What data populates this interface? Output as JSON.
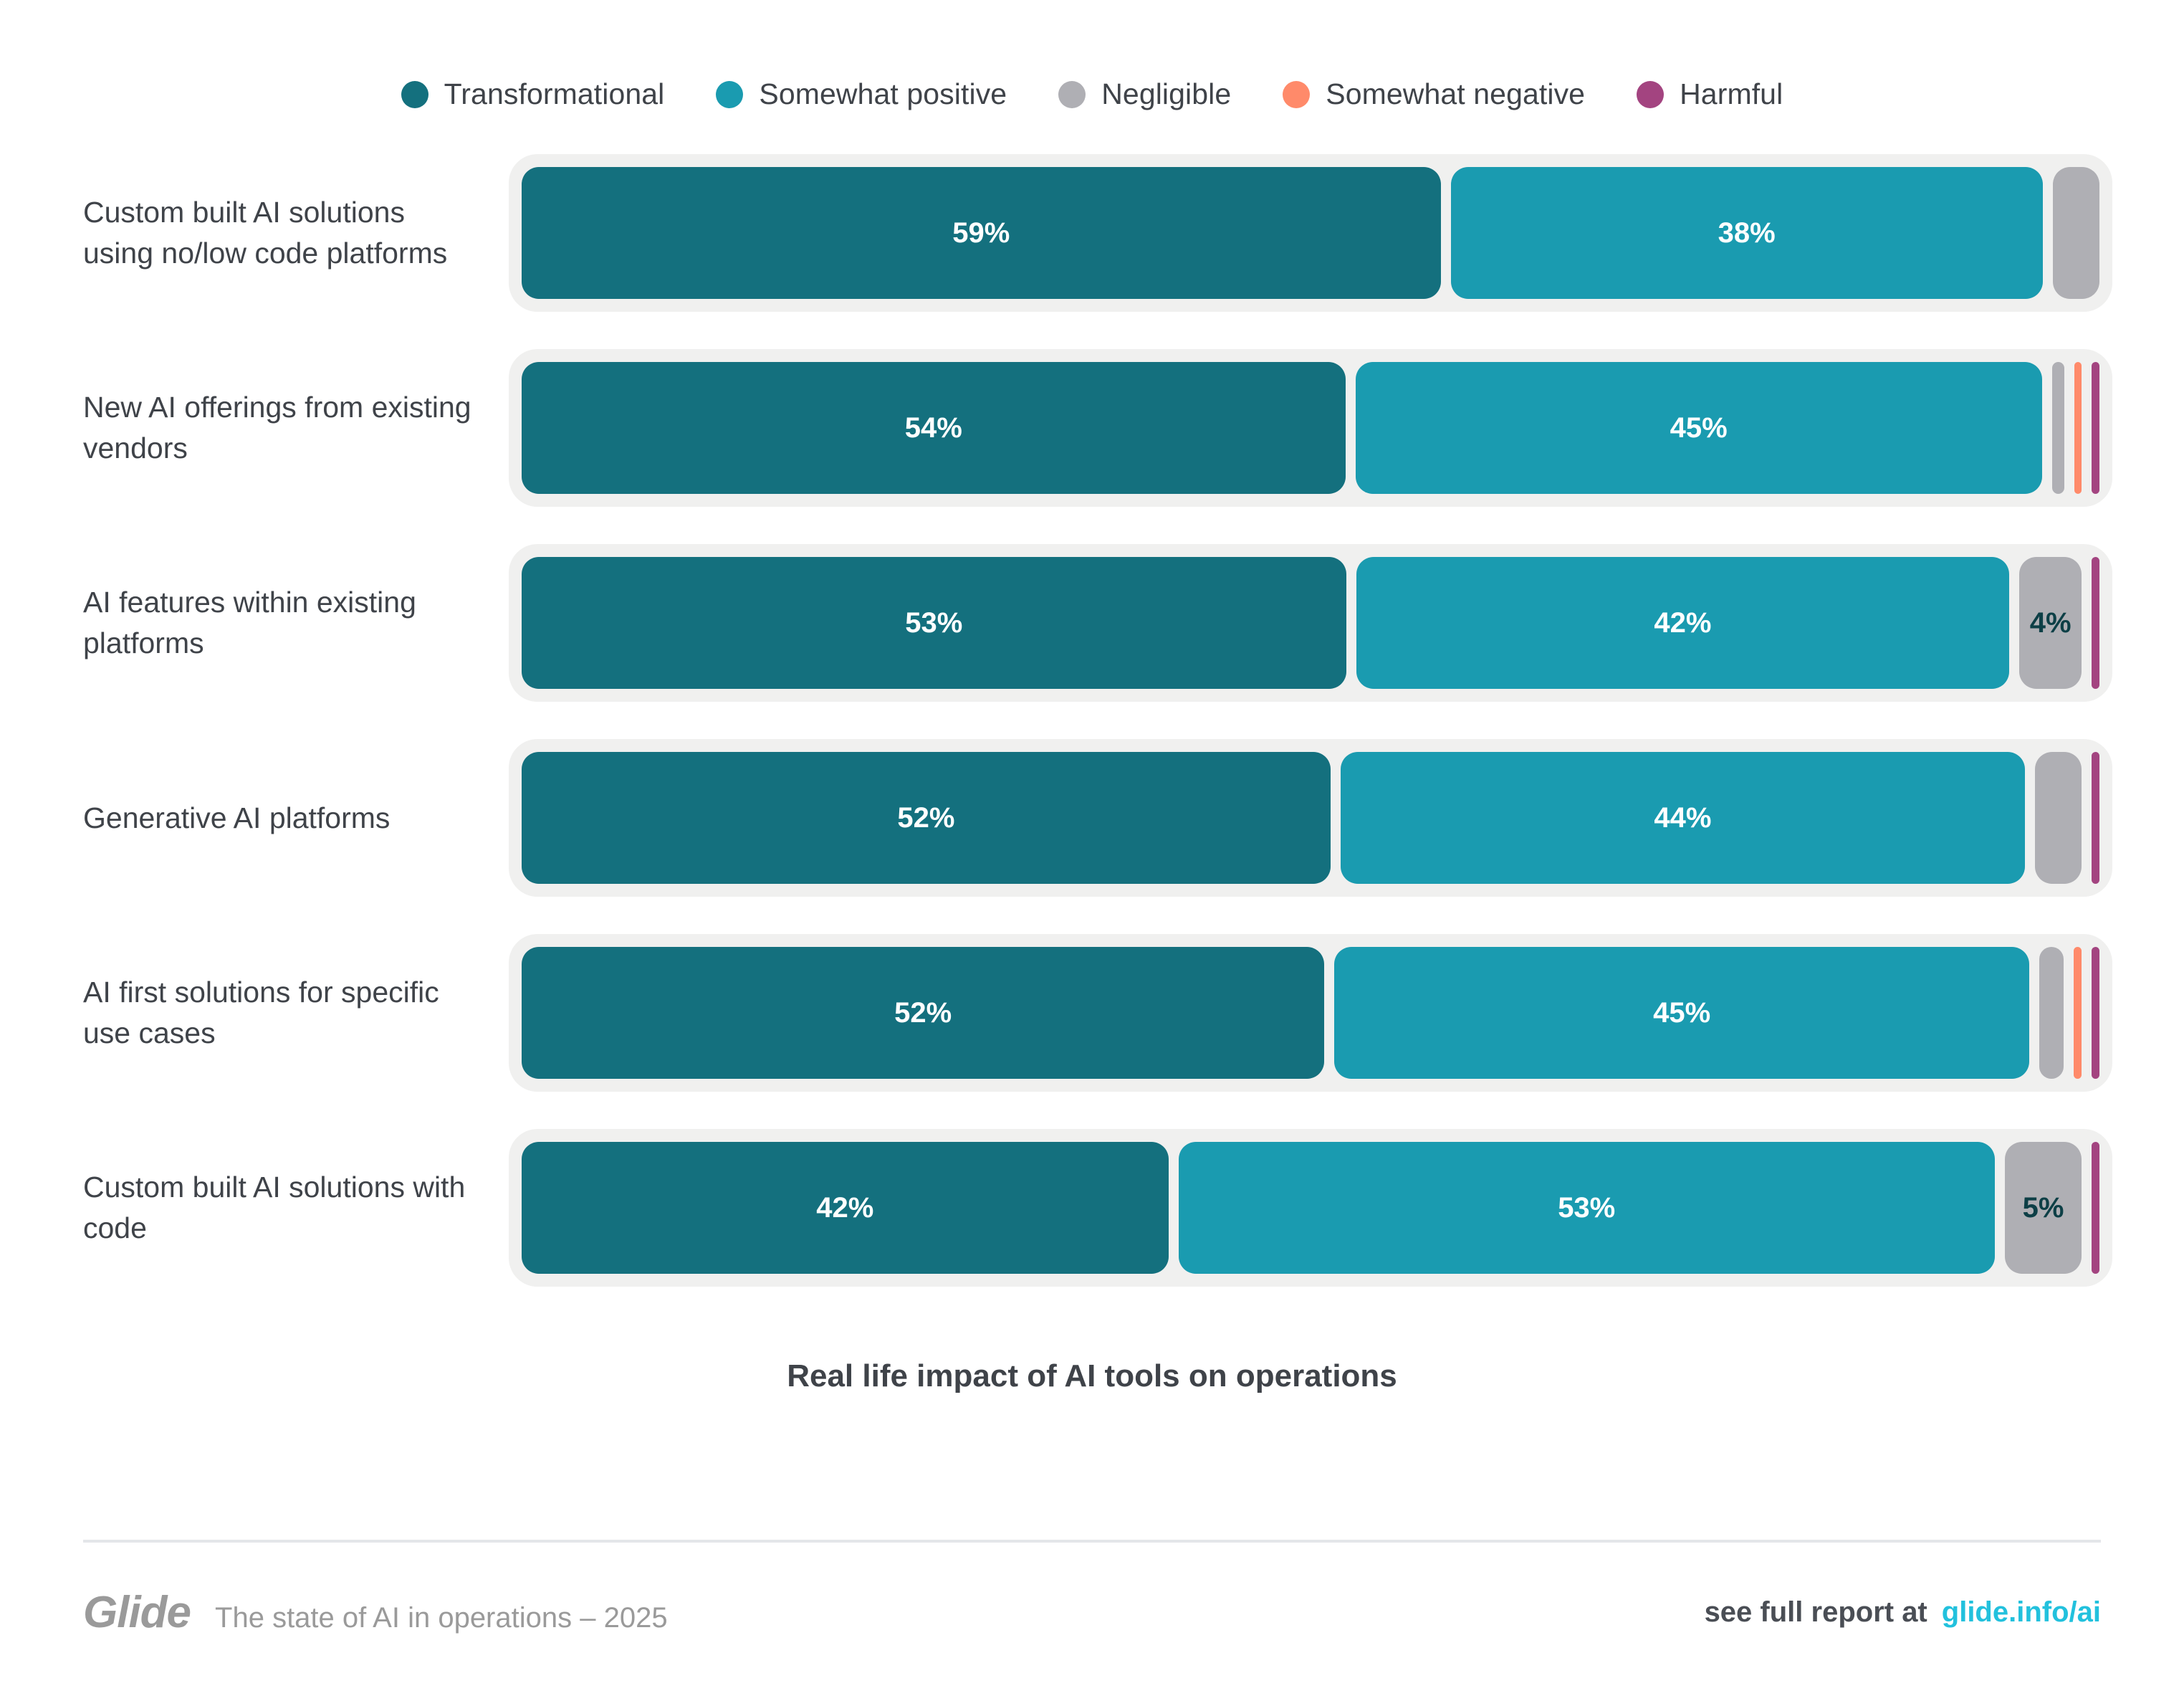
{
  "colors": {
    "transformational": "#14707e",
    "somewhat_positive": "#1a9bb0",
    "negligible": "#afafb4",
    "somewhat_negative": "#ff8a6a",
    "harmful": "#a34480",
    "track": "#f0f0ef",
    "text": "#3f4349",
    "link": "#22c1dd",
    "footer_muted": "#9a9a9a",
    "divider": "#e4e6e9"
  },
  "legend": {
    "items": [
      {
        "label": "Transformational",
        "color_key": "transformational"
      },
      {
        "label": "Somewhat positive",
        "color_key": "somewhat_positive"
      },
      {
        "label": "Negligible",
        "color_key": "negligible"
      },
      {
        "label": "Somewhat negative",
        "color_key": "somewhat_negative"
      },
      {
        "label": "Harmful",
        "color_key": "harmful"
      }
    ]
  },
  "chart_data": {
    "type": "bar",
    "subtype": "stacked-horizontal-100",
    "title": "Real life impact of AI tools on operations",
    "xlabel": "",
    "ylabel": "",
    "xlim": [
      0,
      100
    ],
    "grid": false,
    "legend_position": "top",
    "series": [
      {
        "name": "Transformational",
        "color": "#14707e",
        "values": [
          59,
          54,
          53,
          52,
          52,
          42
        ]
      },
      {
        "name": "Somewhat positive",
        "color": "#1a9bb0",
        "values": [
          38,
          45,
          42,
          44,
          45,
          53
        ]
      },
      {
        "name": "Negligible",
        "color": "#afafb4",
        "values": [
          3,
          0.8,
          4,
          3,
          1.6,
          5
        ]
      },
      {
        "name": "Somewhat negative",
        "color": "#ff8a6a",
        "values": [
          0,
          0.5,
          0,
          0,
          0.5,
          0
        ]
      },
      {
        "name": "Harmful",
        "color": "#a34480",
        "values": [
          0,
          0.5,
          0.5,
          0.5,
          0.5,
          0.5
        ]
      }
    ],
    "categories": [
      "Custom built AI solutions using no/low code platforms",
      "New AI offerings from existing vendors",
      "AI features within existing platforms",
      "Generative AI platforms",
      "AI first solutions for specific use cases",
      "Custom built AI solutions with code"
    ]
  },
  "rows": [
    {
      "label": "Custom built AI solutions using no/low code platforms",
      "segments": [
        {
          "series": "Transformational",
          "value": 59,
          "label": "59%",
          "show_label": true,
          "label_dark": false
        },
        {
          "series": "Somewhat positive",
          "value": 38,
          "label": "38%",
          "show_label": true,
          "label_dark": false
        },
        {
          "series": "Negligible",
          "value": 3,
          "label": "3%",
          "show_label": false,
          "label_dark": true
        }
      ]
    },
    {
      "label": "New AI offerings from existing vendors",
      "segments": [
        {
          "series": "Transformational",
          "value": 54,
          "label": "54%",
          "show_label": true,
          "label_dark": false
        },
        {
          "series": "Somewhat positive",
          "value": 45,
          "label": "45%",
          "show_label": true,
          "label_dark": false
        },
        {
          "series": "Negligible",
          "value": 0.8,
          "label": "",
          "show_label": false,
          "label_dark": true
        },
        {
          "series": "Somewhat negative",
          "value": 0.5,
          "label": "",
          "show_label": false,
          "label_dark": true
        },
        {
          "series": "Harmful",
          "value": 0.5,
          "label": "",
          "show_label": false,
          "label_dark": true
        }
      ]
    },
    {
      "label": "AI features within existing platforms",
      "segments": [
        {
          "series": "Transformational",
          "value": 53,
          "label": "53%",
          "show_label": true,
          "label_dark": false
        },
        {
          "series": "Somewhat positive",
          "value": 42,
          "label": "42%",
          "show_label": true,
          "label_dark": false
        },
        {
          "series": "Negligible",
          "value": 4,
          "label": "4%",
          "show_label": true,
          "label_dark": true
        },
        {
          "series": "Harmful",
          "value": 0.5,
          "label": "",
          "show_label": false,
          "label_dark": true
        }
      ]
    },
    {
      "label": "Generative AI platforms",
      "segments": [
        {
          "series": "Transformational",
          "value": 52,
          "label": "52%",
          "show_label": true,
          "label_dark": false
        },
        {
          "series": "Somewhat positive",
          "value": 44,
          "label": "44%",
          "show_label": true,
          "label_dark": false
        },
        {
          "series": "Negligible",
          "value": 3,
          "label": "",
          "show_label": false,
          "label_dark": true
        },
        {
          "series": "Harmful",
          "value": 0.5,
          "label": "",
          "show_label": false,
          "label_dark": true
        }
      ]
    },
    {
      "label": "AI first solutions for specific use cases",
      "segments": [
        {
          "series": "Transformational",
          "value": 52,
          "label": "52%",
          "show_label": true,
          "label_dark": false
        },
        {
          "series": "Somewhat positive",
          "value": 45,
          "label": "45%",
          "show_label": true,
          "label_dark": false
        },
        {
          "series": "Negligible",
          "value": 1.6,
          "label": "",
          "show_label": false,
          "label_dark": true
        },
        {
          "series": "Somewhat negative",
          "value": 0.5,
          "label": "",
          "show_label": false,
          "label_dark": true
        },
        {
          "series": "Harmful",
          "value": 0.5,
          "label": "",
          "show_label": false,
          "label_dark": true
        }
      ]
    },
    {
      "label": "Custom built AI solutions with code",
      "segments": [
        {
          "series": "Transformational",
          "value": 42,
          "label": "42%",
          "show_label": true,
          "label_dark": false
        },
        {
          "series": "Somewhat positive",
          "value": 53,
          "label": "53%",
          "show_label": true,
          "label_dark": false
        },
        {
          "series": "Negligible",
          "value": 5,
          "label": "5%",
          "show_label": true,
          "label_dark": true
        },
        {
          "series": "Harmful",
          "value": 0.5,
          "label": "",
          "show_label": false,
          "label_dark": true
        }
      ]
    }
  ],
  "title": "Real life impact of AI tools on operations",
  "footer": {
    "brand": "Glide",
    "subtitle": "The state of AI in operations – 2025",
    "cta": "see full report at",
    "link": "glide.info/ai"
  }
}
